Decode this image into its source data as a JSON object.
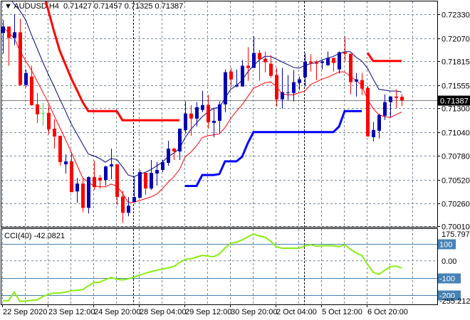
{
  "header": {
    "symbol": "AUDUSD,H4",
    "open": "0.71427",
    "high": "0.71457",
    "low": "0.71325",
    "close": "0.71387",
    "menu_icon": "triangle-down-icon"
  },
  "colors": {
    "bull": "#0000b4",
    "bear": "#ff0000",
    "doji": "#33dd33",
    "ma_slow": "#000080",
    "ma_fast": "#ff0000",
    "upper_step": "#ff0000",
    "lower_step": "#0000ff",
    "cci": "#88ee11",
    "cci_levels": "#4682b4",
    "grid": "#778899",
    "separator": "#000000"
  },
  "chart_data": [
    {
      "type": "candlestick",
      "title": "AUDUSD,H4",
      "ylim": [
        0.70002,
        0.72472
      ],
      "grid": true,
      "price_ticks": [
        "0.72330",
        "0.72070",
        "0.71815",
        "0.71555",
        "0.71300",
        "0.71040",
        "0.70780",
        "0.70520",
        "0.70260",
        "0.70010"
      ],
      "current_price": "0.71387",
      "time_labels": [
        "22 Sep 2020",
        "23 Sep 12:00",
        "24 Sep 20:00",
        "28 Sep 04:00",
        "29 Sep 12:00",
        "30 Sep 20:00",
        "2 Oct 04:00",
        "5 Oct 12:00",
        "6 Oct 20:00"
      ],
      "period_separators_after": [
        "25 Sep 2020",
        "1 Oct 2020"
      ],
      "ohlc": [
        [
          0.72126,
          0.72267,
          0.71899,
          0.72197
        ],
        [
          0.72197,
          0.72197,
          0.71767,
          0.72072
        ],
        [
          0.72072,
          0.7233,
          0.71993,
          0.72134
        ],
        [
          0.72134,
          0.72283,
          0.71548,
          0.71556
        ],
        [
          0.71556,
          0.71727,
          0.71532,
          0.71688
        ],
        [
          0.71649,
          0.71767,
          0.71329,
          0.71336
        ],
        [
          0.71344,
          0.71469,
          0.71141,
          0.71235
        ],
        [
          0.7125,
          0.7136,
          0.7111,
          0.7125
        ],
        [
          0.7125,
          0.71329,
          0.71016,
          0.71071
        ],
        [
          0.71078,
          0.7118,
          0.70859,
          0.70992
        ],
        [
          0.71,
          0.71,
          0.70672,
          0.70711
        ],
        [
          0.70687,
          0.70797,
          0.70586,
          0.70719
        ],
        [
          0.70719,
          0.7082,
          0.70382,
          0.70382
        ],
        [
          0.7039,
          0.70539,
          0.70265,
          0.70476
        ],
        [
          0.70476,
          0.70531,
          0.70163,
          0.7021
        ],
        [
          0.7021,
          0.70554,
          0.70148,
          0.70547
        ],
        [
          0.70547,
          0.70726,
          0.70406,
          0.70437
        ],
        [
          0.70539,
          0.7057,
          0.70422,
          0.70508
        ],
        [
          0.70515,
          0.70672,
          0.70453,
          0.70664
        ],
        [
          0.70664,
          0.70859,
          0.70523,
          0.70687
        ],
        [
          0.70687,
          0.70687,
          0.70242,
          0.70328
        ],
        [
          0.70335,
          0.70398,
          0.70046,
          0.70156
        ],
        [
          0.70156,
          0.70328,
          0.70117,
          0.70234
        ],
        [
          0.70273,
          0.70554,
          0.70273,
          0.70328
        ],
        [
          0.7032,
          0.70625,
          0.7032,
          0.70601
        ],
        [
          0.70594,
          0.70594,
          0.70351,
          0.70422
        ],
        [
          0.70422,
          0.70734,
          0.70406,
          0.70594
        ],
        [
          0.70586,
          0.70711,
          0.70453,
          0.70625
        ],
        [
          0.70625,
          0.70734,
          0.70601,
          0.70711
        ],
        [
          0.70703,
          0.70945,
          0.70672,
          0.70859
        ],
        [
          0.70859,
          0.70867,
          0.70734,
          0.70828
        ],
        [
          0.70828,
          0.71078,
          0.70734,
          0.71078
        ],
        [
          0.71063,
          0.71376,
          0.71024,
          0.71243
        ],
        [
          0.71243,
          0.71336,
          0.71,
          0.71188
        ],
        [
          0.71188,
          0.71368,
          0.71102,
          0.71313
        ],
        [
          0.71282,
          0.71493,
          0.71258,
          0.71336
        ],
        [
          0.71336,
          0.71446,
          0.71078,
          0.71149
        ],
        [
          0.71141,
          0.71305,
          0.70985,
          0.71164
        ],
        [
          0.71164,
          0.71376,
          0.71031,
          0.71344
        ],
        [
          0.71344,
          0.71727,
          0.71258,
          0.71696
        ],
        [
          0.71704,
          0.71743,
          0.71532,
          0.71618
        ],
        [
          0.7154,
          0.71727,
          0.71532,
          0.71556
        ],
        [
          0.7154,
          0.71829,
          0.7154,
          0.71767
        ],
        [
          0.71767,
          0.7197,
          0.71602,
          0.71743
        ],
        [
          0.71743,
          0.72087,
          0.71743,
          0.71907
        ],
        [
          0.71907,
          0.71939,
          0.71602,
          0.71837
        ],
        [
          0.71845,
          0.71923,
          0.71696,
          0.71806
        ],
        [
          0.7179,
          0.71884,
          0.71634,
          0.71657
        ],
        [
          0.71665,
          0.71743,
          0.71321,
          0.71399
        ],
        [
          0.71399,
          0.71743,
          0.71297,
          0.71477
        ],
        [
          0.71469,
          0.71665,
          0.71391,
          0.71477
        ],
        [
          0.71469,
          0.7172,
          0.71376,
          0.71587
        ],
        [
          0.71579,
          0.71649,
          0.71501,
          0.71618
        ],
        [
          0.71641,
          0.71907,
          0.7154,
          0.71813
        ],
        [
          0.71813,
          0.71892,
          0.71704,
          0.71798
        ],
        [
          0.71813,
          0.71829,
          0.7161,
          0.7179
        ],
        [
          0.71798,
          0.71829,
          0.71727,
          0.71813
        ],
        [
          0.71774,
          0.71923,
          0.71767,
          0.71853
        ],
        [
          0.71853,
          0.71853,
          0.71704,
          0.71798
        ],
        [
          0.71727,
          0.71923,
          0.71681,
          0.71915
        ],
        [
          0.71915,
          0.72087,
          0.71813,
          0.71899
        ],
        [
          0.71899,
          0.71899,
          0.71454,
          0.71587
        ],
        [
          0.71594,
          0.71688,
          0.7143,
          0.71618
        ],
        [
          0.7161,
          0.71688,
          0.71446,
          0.71516
        ],
        [
          0.71524,
          0.71548,
          0.70992,
          0.70992
        ],
        [
          0.70985,
          0.71149,
          0.70938,
          0.71063
        ],
        [
          0.71055,
          0.71243,
          0.70969,
          0.71227
        ],
        [
          0.71219,
          0.71454,
          0.71172,
          0.71368
        ],
        [
          0.71368,
          0.7143,
          0.71204,
          0.7143
        ],
        [
          0.7143,
          0.71508,
          0.71305,
          0.71415
        ],
        [
          0.71427,
          0.71457,
          0.71325,
          0.71387
        ]
      ],
      "overlays": {
        "ma_slow": [
          0.7262,
          0.7252,
          0.7244,
          0.7237,
          0.7227,
          0.7211,
          0.7196,
          0.7181,
          0.7167,
          0.7154,
          0.714,
          0.7127,
          0.7113,
          0.7102,
          0.7091,
          0.708,
          0.7078,
          0.7075,
          0.7071,
          0.7075,
          0.7074,
          0.7066,
          0.7057,
          0.7055,
          0.7058,
          0.706,
          0.7063,
          0.7067,
          0.7071,
          0.7077,
          0.7081,
          0.7086,
          0.7098,
          0.7107,
          0.7114,
          0.7121,
          0.7126,
          0.713,
          0.7131,
          0.7141,
          0.7151,
          0.7155,
          0.7161,
          0.717,
          0.7177,
          0.7183,
          0.7187,
          0.7187,
          0.7184,
          0.7181,
          0.7178,
          0.7175,
          0.7174,
          0.7177,
          0.7179,
          0.718,
          0.7183,
          0.7185,
          0.7187,
          0.719,
          0.7192,
          0.7192,
          0.7186,
          0.7182,
          0.7174,
          0.7162,
          0.7151,
          0.715,
          0.7149,
          0.7149,
          0.7148
        ],
        "ma_fast": [
          0.7219,
          0.7213,
          0.7207,
          0.7193,
          0.7182,
          0.7172,
          0.716,
          0.7148,
          0.7136,
          0.7122,
          0.7109,
          0.7096,
          0.7082,
          0.7068,
          0.7054,
          0.7049,
          0.7045,
          0.7044,
          0.7044,
          0.7047,
          0.7045,
          0.7037,
          0.7027,
          0.7027,
          0.7029,
          0.7031,
          0.7033,
          0.7036,
          0.7042,
          0.7049,
          0.7055,
          0.7063,
          0.7077,
          0.7082,
          0.7089,
          0.7098,
          0.71,
          0.7101,
          0.7102,
          0.7109,
          0.7119,
          0.7127,
          0.7134,
          0.7143,
          0.7152,
          0.7155,
          0.7158,
          0.7159,
          0.7154,
          0.7146,
          0.7145,
          0.7145,
          0.7147,
          0.7149,
          0.7156,
          0.7159,
          0.7162,
          0.7164,
          0.7167,
          0.717,
          0.717,
          0.7165,
          0.7161,
          0.7155,
          0.714,
          0.713,
          0.7123,
          0.7121,
          0.712,
          0.7123,
          0.7126
        ],
        "upper_step": [
          null,
          null,
          null,
          null,
          null,
          null,
          null,
          0.726,
          0.7237,
          0.7214,
          0.7193,
          0.7178,
          0.7163,
          0.715,
          0.7137,
          0.7127,
          0.7127,
          0.7127,
          0.7127,
          0.7127,
          0.7127,
          0.7117,
          0.7117,
          0.7117,
          0.7117,
          0.7117,
          0.7117,
          0.7117,
          0.7117,
          0.7117,
          0.7117,
          0.7117,
          null,
          null,
          null,
          null,
          null,
          null,
          null,
          null,
          null,
          null,
          null,
          null,
          null,
          null,
          null,
          null,
          null,
          null,
          null,
          null,
          null,
          null,
          null,
          null,
          null,
          null,
          null,
          null,
          null,
          null,
          null,
          null,
          0.7191,
          0.7182,
          0.7182,
          0.7182,
          0.7182,
          0.7182,
          0.7182
        ],
        "lower_step": [
          null,
          null,
          null,
          null,
          null,
          null,
          null,
          null,
          null,
          null,
          null,
          null,
          null,
          null,
          null,
          null,
          null,
          null,
          null,
          null,
          null,
          null,
          null,
          null,
          null,
          null,
          null,
          null,
          null,
          null,
          null,
          null,
          0.7045,
          0.7045,
          0.7045,
          0.7057,
          0.7057,
          0.7057,
          0.7058,
          0.7072,
          0.7072,
          0.7072,
          0.7077,
          0.7092,
          0.7104,
          0.7104,
          0.7104,
          0.7104,
          0.7104,
          0.7104,
          0.7104,
          0.7104,
          0.7104,
          0.7104,
          0.7104,
          0.7104,
          0.7104,
          0.7104,
          0.7104,
          0.711,
          0.7127,
          0.7127,
          0.7127,
          0.7127,
          null,
          null,
          null,
          null,
          null,
          null,
          null
        ]
      }
    },
    {
      "type": "line",
      "title": "CCI(40)",
      "current_value": "-42.0821",
      "ylim": [
        -254,
        186
      ],
      "max_label": "175.7978",
      "min_label": "-255.2124",
      "levels": [
        {
          "value": 100,
          "label": "100"
        },
        {
          "value": -100,
          "label": "-100"
        },
        {
          "value": -200,
          "label": "-200"
        }
      ],
      "zero_label": "0.00",
      "values": [
        -233,
        -233,
        -183,
        -237,
        -234,
        -231,
        -228,
        -209,
        -195,
        -188,
        -188,
        -183,
        -174,
        -172,
        -168,
        -146,
        -126,
        -125,
        -110,
        -97,
        -107,
        -111,
        -105,
        -95,
        -83,
        -73,
        -63,
        -55,
        -47,
        -42,
        -33,
        -10,
        8,
        12,
        22,
        32,
        28,
        24,
        40,
        75,
        104,
        109,
        122,
        140,
        157,
        145,
        138,
        115,
        82,
        74,
        74,
        74,
        74,
        87,
        94,
        86,
        88,
        89,
        88,
        83,
        94,
        68,
        46,
        32,
        -19,
        -67,
        -79,
        -56,
        -33,
        -31,
        -42.08
      ]
    }
  ]
}
